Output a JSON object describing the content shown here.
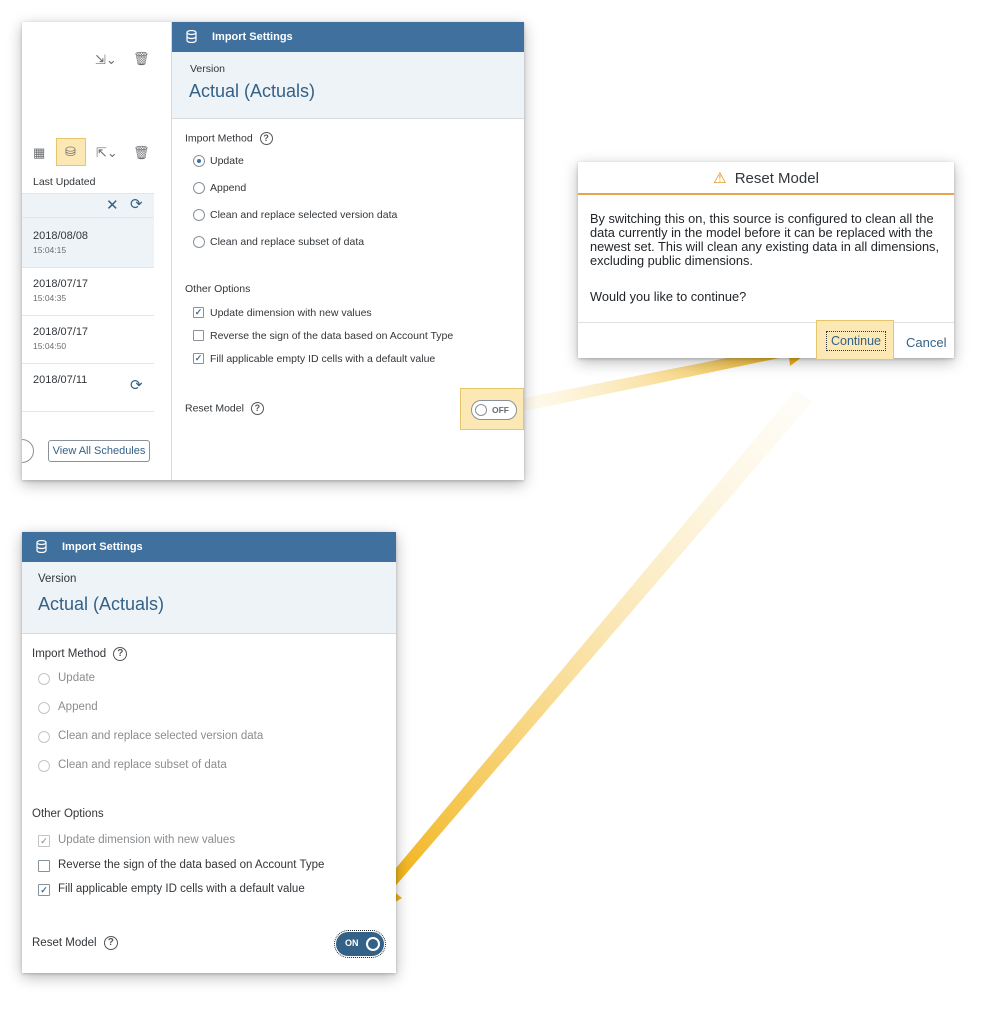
{
  "left_panel": {
    "column_header": "Last Updated",
    "rows": [
      {
        "date": "2018/08/08",
        "time": "15:04:15"
      },
      {
        "date": "2018/07/17",
        "time": "15:04:35"
      },
      {
        "date": "2018/07/17",
        "time": "15:04:50"
      },
      {
        "date": "2018/07/11",
        "time": ""
      }
    ],
    "view_all_label": "View All Schedules"
  },
  "import_settings": {
    "title": "Import Settings",
    "version_label": "Version",
    "version_value": "Actual (Actuals)",
    "import_method_label": "Import Method",
    "methods": [
      "Update",
      "Append",
      "Clean and replace selected version data",
      "Clean and replace subset of data"
    ],
    "other_options_label": "Other Options",
    "options": [
      "Update dimension with new values",
      "Reverse the sign of the data based on Account Type",
      "Fill applicable empty ID cells with a default value"
    ],
    "reset_model_label": "Reset Model",
    "toggle_off": "OFF",
    "toggle_on": "ON"
  },
  "dialog": {
    "title": "Reset Model",
    "body": "By switching this on, this source is configured to clean all the data currently in the model before it can be replaced with the newest set. This will clean any existing data in all dimensions, excluding public dimensions.",
    "question": "Would you like to continue?",
    "continue_label": "Continue",
    "cancel_label": "Cancel"
  },
  "colors": {
    "header_blue": "#3f709e",
    "highlight_yellow": "#fbe8b4",
    "arrow_orange": "#f0ab00",
    "link_blue": "#0a6ed1"
  }
}
